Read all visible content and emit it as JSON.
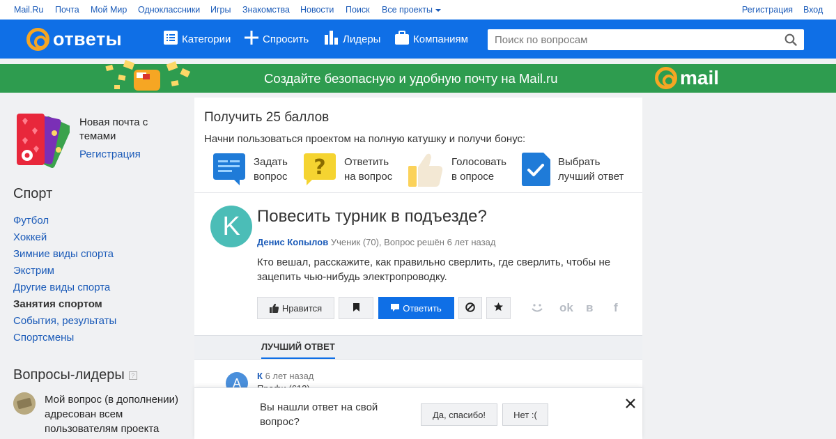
{
  "portal": {
    "left_links": [
      "Mail.Ru",
      "Почта",
      "Мой Мир",
      "Одноклассники",
      "Игры",
      "Знакомства",
      "Новости",
      "Поиск",
      "Все проекты"
    ],
    "register": "Регистрация",
    "login": "Вход"
  },
  "header": {
    "logo_text": "ответы",
    "nav": [
      "Категории",
      "Спросить",
      "Лидеры",
      "Компаниям"
    ],
    "search_placeholder": "Поиск по вопросам"
  },
  "banner": {
    "text": "Создайте безопасную и удобную почту на Mail.ru",
    "brand": "mail"
  },
  "sidebar": {
    "promo_title": "Новая почта с темами",
    "promo_link": "Регистрация",
    "category_heading": "Спорт",
    "categories": [
      "Футбол",
      "Хоккей",
      "Зимние виды спорта",
      "Экстрим",
      "Другие виды спорта",
      "Занятия спортом",
      "События, результаты",
      "Спортсмены"
    ],
    "active_category": "Занятия спортом",
    "leaders_heading": "Вопросы-лидеры",
    "leader_question": "Мой вопрос (в дополнении) адресован всем пользователям проекта"
  },
  "bonus": {
    "title": "Получить 25 баллов",
    "subtitle": "Начни пользоваться проектом на полную катушку и получи бонус:",
    "items": [
      {
        "line1": "Задать",
        "line2": "вопрос"
      },
      {
        "line1": "Ответить",
        "line2": "на вопрос"
      },
      {
        "line1": "Голосовать",
        "line2": "в опросе"
      },
      {
        "line1": "Выбрать",
        "line2": "лучший ответ"
      }
    ]
  },
  "question": {
    "avatar_letter": "K",
    "title": "Повесить турник в подъезде?",
    "author": "Денис Копылов",
    "meta": "Ученик (70), Вопрос решён 6 лет назад",
    "text": "Кто вешал, расскажите, как правильно сверлить, где сверлить, чтобы не зацепить чью-нибудь электропроводку.",
    "like_label": "Нравится",
    "answer_label": "Ответить",
    "share": [
      "ok",
      "в",
      "f"
    ]
  },
  "tabs": {
    "best_answer": "ЛУЧШИЙ ОТВЕТ"
  },
  "answer": {
    "avatar_letter": "A",
    "author": "К",
    "time": "6 лет назад",
    "rank": "Профи (612)"
  },
  "feedback": {
    "question": "Вы нашли ответ на свой вопрос?",
    "yes": "Да, спасибо!",
    "no": "Нет :("
  },
  "colors": {
    "brand_blue": "#0f6fe6",
    "banner_green": "#2e9c4f",
    "accent_orange": "#f6a623",
    "link_blue": "#1a5ab8",
    "avatar_teal": "#4bbdb7"
  }
}
